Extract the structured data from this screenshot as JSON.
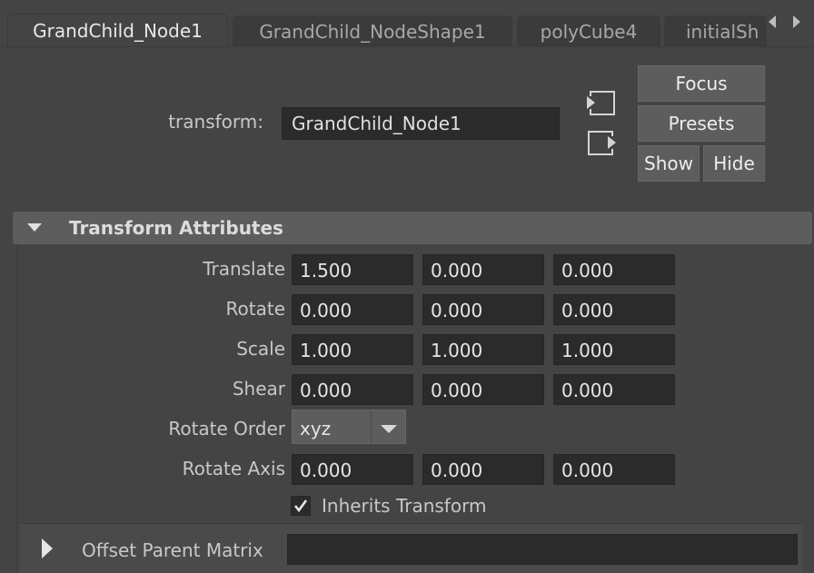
{
  "tabs": [
    {
      "label": "GrandChild_Node1",
      "active": true
    },
    {
      "label": "GrandChild_NodeShape1",
      "active": false
    },
    {
      "label": "polyCube4",
      "active": false
    },
    {
      "label": "initialSh",
      "active": false
    }
  ],
  "header": {
    "transform_label": "transform:",
    "transform_value": "GrandChild_Node1",
    "focus_label": "Focus",
    "presets_label": "Presets",
    "show_label": "Show",
    "hide_label": "Hide"
  },
  "transform_section": {
    "title": "Transform Attributes",
    "translate": {
      "label": "Translate",
      "values": [
        "1.500",
        "0.000",
        "0.000"
      ]
    },
    "rotate": {
      "label": "Rotate",
      "values": [
        "0.000",
        "0.000",
        "0.000"
      ]
    },
    "scale": {
      "label": "Scale",
      "values": [
        "1.000",
        "1.000",
        "1.000"
      ]
    },
    "shear": {
      "label": "Shear",
      "values": [
        "0.000",
        "0.000",
        "0.000"
      ]
    },
    "rotate_order": {
      "label": "Rotate Order",
      "value": "xyz"
    },
    "rotate_axis": {
      "label": "Rotate Axis",
      "values": [
        "0.000",
        "0.000",
        "0.000"
      ]
    },
    "inherits_transform": {
      "label": "Inherits Transform",
      "checked": true
    }
  },
  "offset_section": {
    "title": "Offset Parent Matrix"
  },
  "icons": {
    "tab_scroll_left": "triangle-left-icon",
    "tab_scroll_right": "triangle-right-icon",
    "input_connection": "input-connection-icon",
    "output_connection": "output-connection-icon",
    "section_expanded": "triangle-down-icon",
    "section_collapsed": "triangle-right-icon",
    "dropdown": "triangle-down-icon",
    "checkmark": "checkmark-icon"
  },
  "colors": {
    "background": "#444444",
    "field": "#2b2b2b",
    "button": "#5d5d5d",
    "text": "#dadada"
  }
}
